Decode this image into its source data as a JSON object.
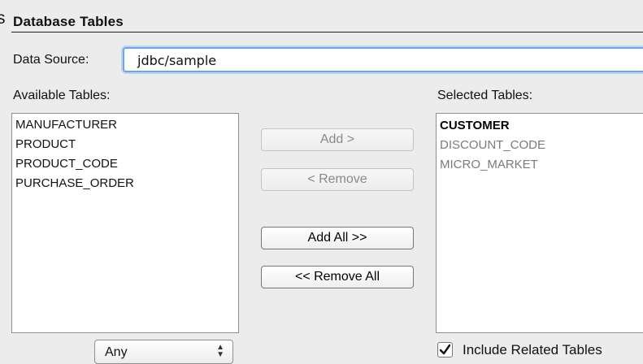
{
  "header": {
    "cut_letter": "s",
    "section_title": "Database Tables"
  },
  "data_source": {
    "label": "Data Source:",
    "value": "jdbc/sample"
  },
  "available": {
    "label": "Available Tables:",
    "items": [
      "MANUFACTURER",
      "PRODUCT",
      "PRODUCT_CODE",
      "PURCHASE_ORDER"
    ]
  },
  "selected": {
    "label": "Selected Tables:",
    "items": [
      {
        "text": "CUSTOMER",
        "state": "selected"
      },
      {
        "text": "DISCOUNT_CODE",
        "state": "dimmed"
      },
      {
        "text": "MICRO_MARKET",
        "state": "dimmed"
      }
    ]
  },
  "buttons": {
    "add": "Add >",
    "remove": "< Remove",
    "add_all": "Add All >>",
    "remove_all": "<< Remove All"
  },
  "filter": {
    "value": "Any",
    "arrows_icon": "up-down-chevron-icon"
  },
  "include_related": {
    "label": "Include Related Tables",
    "checked": true
  }
}
